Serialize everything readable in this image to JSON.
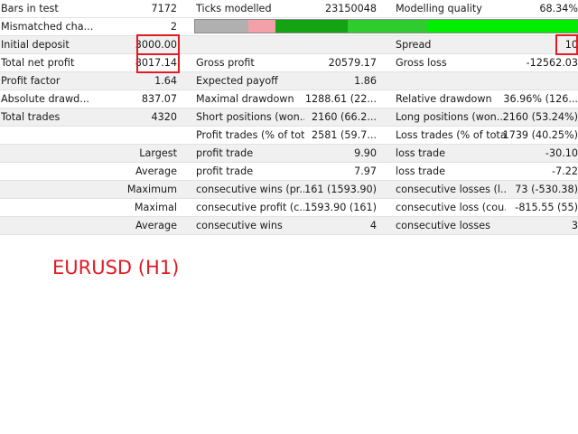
{
  "rows": {
    "bars": {
      "label": "Bars in test",
      "value": "7172",
      "label2": "Ticks modelled",
      "value2": "23150048",
      "label3": "Modelling quality",
      "value3": "68.34%"
    },
    "mismatch": {
      "label": "Mismatched cha...",
      "value": "2"
    },
    "deposit": {
      "label": "Initial deposit",
      "value": "3000.00",
      "label3": "Spread",
      "value3": "10"
    },
    "net": {
      "label": "Total net profit",
      "value": "8017.14",
      "label2": "Gross profit",
      "value2": "20579.17",
      "label3": "Gross loss",
      "value3": "-12562.03"
    },
    "pf": {
      "label": "Profit factor",
      "value": "1.64",
      "label2": "Expected payoff",
      "value2": "1.86"
    },
    "dd": {
      "label": "Absolute drawd...",
      "value": "837.07",
      "label2": "Maximal drawdown",
      "value2": "1288.61 (22...",
      "label3": "Relative drawdown",
      "value3": "36.96% (126..."
    },
    "trades": {
      "label": "Total trades",
      "value": "4320",
      "label2": "Short positions (won...",
      "value2": "2160 (66.2...",
      "label3": "Long positions (won...",
      "value3": "2160 (53.24%)"
    },
    "pt": {
      "label2": "Profit trades (% of tot...",
      "value2": "2581 (59.7...",
      "label3": "Loss trades (% of total)",
      "value3": "1739 (40.25%)"
    },
    "largest": {
      "label": "Largest",
      "label2": "profit trade",
      "value2": "9.90",
      "label3": "loss trade",
      "value3": "-30.10"
    },
    "average": {
      "label": "Average",
      "label2": "profit trade",
      "value2": "7.97",
      "label3": "loss trade",
      "value3": "-7.22"
    },
    "maximum": {
      "label": "Maximum",
      "label2": "consecutive wins (pr...",
      "value2": "161 (1593.90)",
      "label3": "consecutive losses (l...",
      "value3": "73 (-530.38)"
    },
    "maximal": {
      "label": "Maximal",
      "label2": "consecutive profit (c...",
      "value2": "1593.90 (161)",
      "label3": "consecutive loss (cou...",
      "value3": "-815.55 (55)"
    },
    "avgcons": {
      "label": "Average",
      "label2": "consecutive wins",
      "value2": "4",
      "label3": "consecutive losses",
      "value3": "3"
    }
  },
  "quality_bar": {
    "segments": [
      {
        "color": "#b0b0b0",
        "start": 0.0,
        "end": 0.14
      },
      {
        "color": "#f4a0a8",
        "start": 0.14,
        "end": 0.21
      },
      {
        "color": "#13a313",
        "start": 0.21,
        "end": 0.4
      },
      {
        "color": "#2ecc2e",
        "start": 0.4,
        "end": 0.61
      },
      {
        "color": "#00ee00",
        "start": 0.61,
        "end": 1.0
      }
    ]
  },
  "highlight_color": "#e01b24",
  "symbol": "EURUSD (H1)"
}
